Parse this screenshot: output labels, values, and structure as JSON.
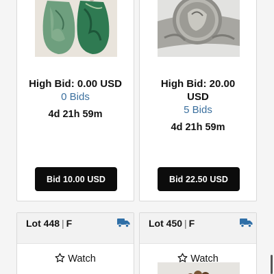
{
  "lots": [
    {
      "image": "jade-pendant-earrings-photo",
      "high_bid": "High Bid: 0.00 USD",
      "bids": "0 Bids",
      "time_left": "4d 21h 59m",
      "bid_button": "Bid 10.00 USD"
    },
    {
      "image": "silver-coin-ring-photo",
      "high_bid": "High Bid: 20.00 USD",
      "bids": "5 Bids",
      "time_left": "4d 21h 59m",
      "bid_button": "Bid 22.50 USD"
    },
    {
      "lot_number": "Lot 448",
      "lot_suffix": "F",
      "separator": "|",
      "watch_label": "Watch",
      "shipping_icon": "truck-icon"
    },
    {
      "lot_number": "Lot 450",
      "lot_suffix": "F",
      "separator": "|",
      "watch_label": "Watch",
      "shipping_icon": "truck-icon",
      "image": "beaded-bracelet-photo"
    }
  ],
  "colors": {
    "bid_button_bg": "#0c0c0c",
    "bids_link": "#3a6f9e",
    "truck_icon": "#2f6fa7"
  }
}
